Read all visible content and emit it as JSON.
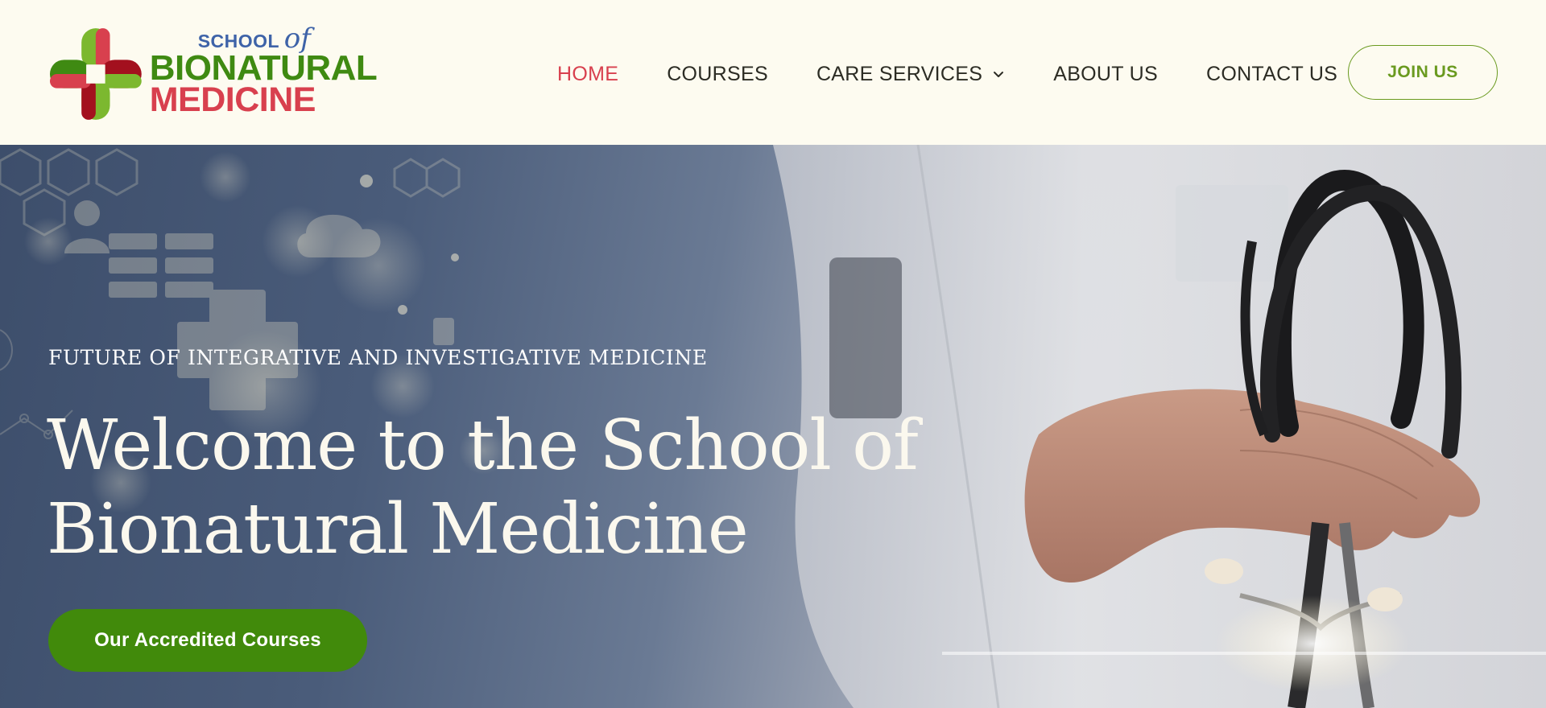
{
  "brand": {
    "line1": "SCHOOL",
    "line1_script": "of",
    "line2": "BIONATURAL",
    "line3": "MEDICINE",
    "colors": {
      "green": "#3f8a12",
      "light_green": "#7cb82f",
      "red": "#d8404e",
      "dark_red": "#a3101e",
      "blue": "#3e63a8"
    }
  },
  "nav": {
    "items": [
      {
        "label": "HOME",
        "active": true
      },
      {
        "label": "COURSES",
        "active": false
      },
      {
        "label": "CARE SERVICES",
        "active": false,
        "has_dropdown": true
      },
      {
        "label": "ABOUT US",
        "active": false
      },
      {
        "label": "CONTACT US",
        "active": false
      }
    ],
    "join_label": "JOIN US",
    "dropdown_icon": "chevron-down-icon"
  },
  "hero": {
    "eyebrow": "FUTURE OF INTEGRATIVE AND INVESTIGATIVE MEDICINE",
    "title": "Welcome to the School of Bionatural Medicine",
    "cta_label": "Our Accredited Courses",
    "image_subject": "doctor in white coat holding stethoscope",
    "colors": {
      "cta": "#418a0b",
      "overlay": "#3d4e6b"
    }
  }
}
